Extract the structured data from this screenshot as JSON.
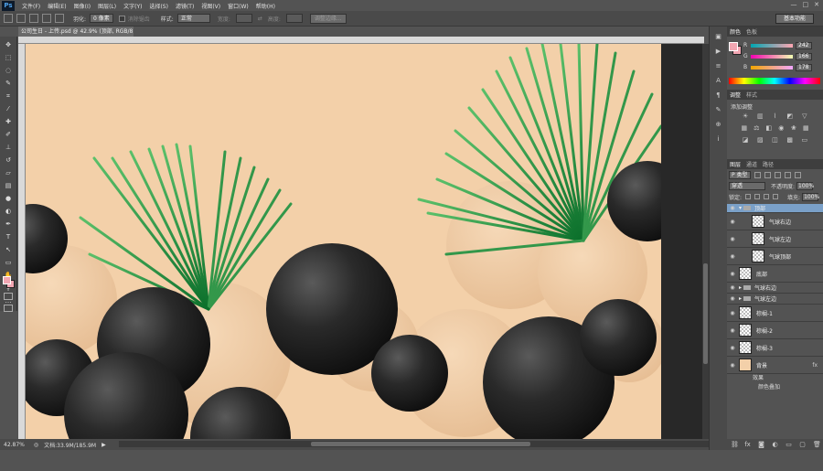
{
  "menubar": {
    "logo": "Ps",
    "items": [
      "文件(F)",
      "编辑(E)",
      "图像(I)",
      "图层(L)",
      "文字(Y)",
      "选择(S)",
      "滤镜(T)",
      "视图(V)",
      "窗口(W)",
      "帮助(H)"
    ],
    "window_controls": [
      "—",
      "□",
      "✕"
    ]
  },
  "options_bar": {
    "feather_label": "羽化:",
    "feather_value": "0 像素",
    "antialias_label": "消除锯齿",
    "style_label": "样式:",
    "style_value": "正常",
    "width_label": "宽度:",
    "height_label": "高度:",
    "refine_button": "调整边缘...",
    "workspace_button": "基本功能"
  },
  "document": {
    "tab_title": "公司生日 - 上传.psd @ 42.9% (顶部, RGB/8) *",
    "zoom": "42.87%",
    "doc_size": "文档:33.9M/185.9M"
  },
  "color_panel": {
    "tabs": [
      "颜色",
      "色板"
    ],
    "r_label": "R",
    "r_value": "242",
    "g_label": "G",
    "g_value": "166",
    "b_label": "B",
    "b_value": "178",
    "foreground_color": "#f2a6b2"
  },
  "adjust_panel": {
    "tabs": [
      "调整",
      "样式"
    ],
    "label": "添加调整"
  },
  "layers_panel": {
    "tabs": [
      "图层",
      "通道",
      "路径"
    ],
    "filter_kind": "P 类型",
    "blend_mode": "穿透",
    "opacity_label": "不透明度:",
    "opacity_value": "100%",
    "lock_label": "锁定:",
    "fill_label": "填充:",
    "fill_value": "100%",
    "layers": [
      {
        "name": "顶部",
        "type": "group-open"
      },
      {
        "name": "气球右边",
        "type": "layer",
        "indent": true
      },
      {
        "name": "气球左边",
        "type": "layer",
        "indent": true
      },
      {
        "name": "气球顶部",
        "type": "layer",
        "indent": true
      },
      {
        "name": "底部",
        "type": "layer"
      },
      {
        "name": "气球右边",
        "type": "group"
      },
      {
        "name": "气球左边",
        "type": "group"
      },
      {
        "name": "棕榈-1",
        "type": "layer"
      },
      {
        "name": "棕榈-2",
        "type": "layer"
      },
      {
        "name": "棕榈-3",
        "type": "layer"
      },
      {
        "name": "背景",
        "type": "fill",
        "fx": "fx"
      }
    ],
    "effects_label": "效果",
    "effect_item": "颜色叠加"
  },
  "colors": {
    "canvas_bg": "#f3d0a9",
    "accent_green": "#1a8a3a",
    "ball_dark": "#1e1e1e"
  }
}
